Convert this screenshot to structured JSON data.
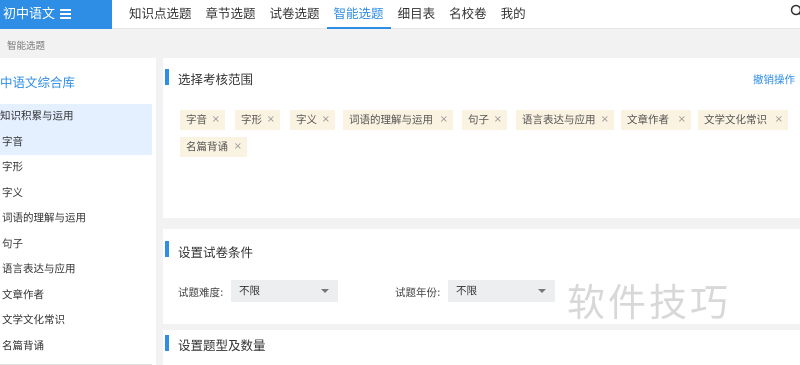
{
  "brand": {
    "title": "初中语文"
  },
  "nav": {
    "items": [
      "知识点选题",
      "章节选题",
      "试卷选题",
      "智能选题",
      "细目表",
      "名校卷",
      "我的"
    ],
    "active_index": 3
  },
  "breadcrumb": "智能选题",
  "sidebar": {
    "title": "中语文综合库",
    "items": [
      "知识积累与运用",
      "字音",
      "字形",
      "字义",
      "词语的理解与运用",
      "句子",
      "语言表达与应用",
      "文章作者",
      "文学文化常识",
      "名篇背诵"
    ]
  },
  "scope_panel": {
    "title": "选择考核范围",
    "undo_label": "撤销操作",
    "tags": [
      "字音",
      "字形",
      "字义",
      "词语的理解与运用",
      "句子",
      "语言表达与应用",
      "文章作者",
      "文学文化常识",
      "名篇背诵"
    ],
    "remove_glyph": "×"
  },
  "conditions_panel": {
    "title": "设置试卷条件",
    "difficulty_label": "试题难度:",
    "difficulty_value": "不限",
    "year_label": "试题年份:",
    "year_value": "不限"
  },
  "types_panel": {
    "title": "设置题型及数量"
  },
  "watermark": "软件技巧",
  "colors": {
    "accent": "#2e8de5",
    "tag_bg": "#fbf3e2",
    "selected_bg": "#e4efff"
  }
}
